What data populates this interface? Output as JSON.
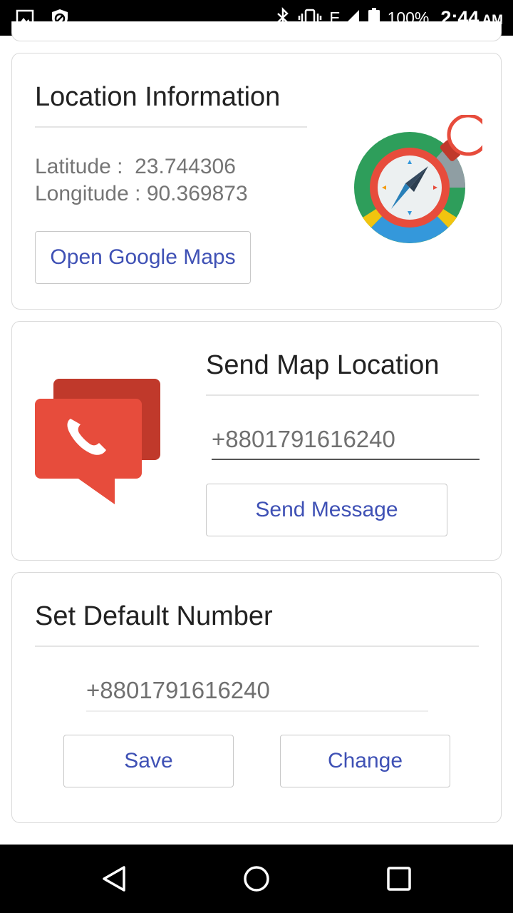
{
  "status_bar": {
    "battery_percent": "100%",
    "time": "2:44",
    "ampm": "AM",
    "network": "E",
    "icons": [
      "gallery-icon",
      "shield-icon",
      "bluetooth-icon",
      "vibrate-icon",
      "signal-icon",
      "battery-icon"
    ]
  },
  "location_card": {
    "title": "Location Information",
    "latitude_label": "Latitude :",
    "latitude_value": "23.744306",
    "longitude_label": "Longitude :",
    "longitude_value": "90.369873",
    "open_maps_label": "Open Google Maps"
  },
  "send_card": {
    "title": "Send Map Location",
    "phone_value": "+8801791616240",
    "send_label": "Send Message"
  },
  "default_card": {
    "title": "Set Default Number",
    "phone_value": "+8801791616240",
    "save_label": "Save",
    "change_label": "Change"
  },
  "colors": {
    "accent": "#3f51b5",
    "red": "#e74c3c",
    "dark_red": "#c0392b"
  }
}
